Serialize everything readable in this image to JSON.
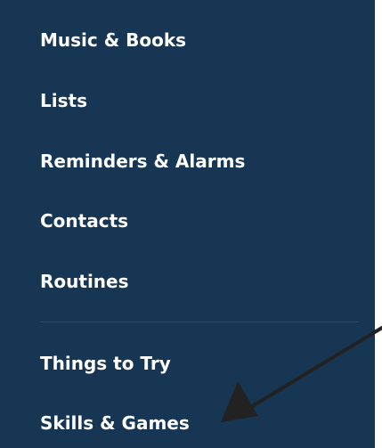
{
  "menu": {
    "items": [
      {
        "label": "Music & Books"
      },
      {
        "label": "Lists"
      },
      {
        "label": "Reminders & Alarms"
      },
      {
        "label": "Contacts"
      },
      {
        "label": "Routines"
      },
      {
        "label": "Things to Try"
      },
      {
        "label": "Skills & Games"
      }
    ]
  },
  "colors": {
    "panel_background": "#163653",
    "text": "#ffffff",
    "divider": "#2d4c67",
    "annotation_arrow": "#222222"
  },
  "annotation": {
    "icon": "arrow-pointer-icon",
    "points_to": "Skills & Games"
  }
}
